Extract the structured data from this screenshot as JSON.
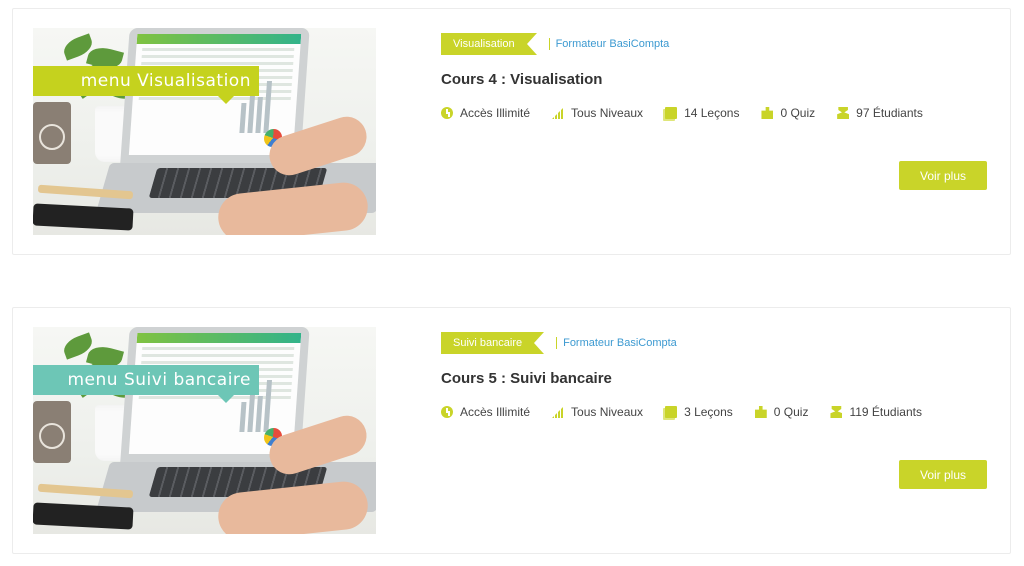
{
  "courses": [
    {
      "thumbnail_caption": "menu Visualisation",
      "category": "Visualisation",
      "trainer": "Formateur BasiCompta",
      "title": "Cours 4 : Visualisation",
      "access": "Accès Illimité",
      "level": "Tous Niveaux",
      "lessons": "14 Leçons",
      "quiz": "0 Quiz",
      "students": "97 Étudiants",
      "button_label": "Voir plus",
      "ribbon_color": "#c5d21e"
    },
    {
      "thumbnail_caption": "menu Suivi bancaire",
      "category": "Suivi bancaire",
      "trainer": "Formateur BasiCompta",
      "title": "Cours 5 : Suivi bancaire",
      "access": "Accès Illimité",
      "level": "Tous Niveaux",
      "lessons": "3 Leçons",
      "quiz": "0 Quiz",
      "students": "119 Étudiants",
      "button_label": "Voir plus",
      "ribbon_color": "#6dc6b6"
    }
  ],
  "colors": {
    "accent": "#c9d429",
    "link": "#3d9ad1"
  }
}
